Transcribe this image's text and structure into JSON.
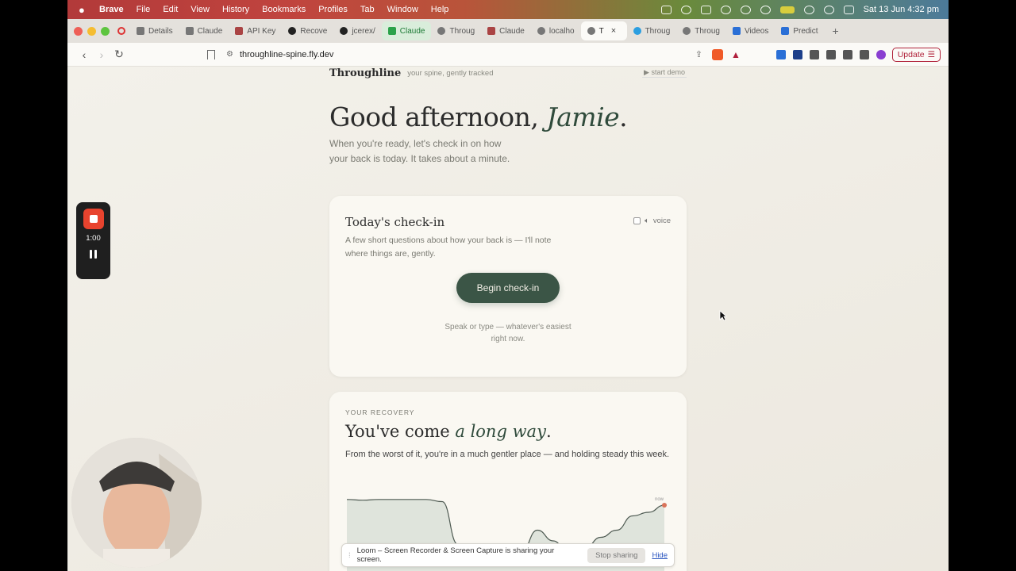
{
  "menubar": {
    "app": "Brave",
    "items": [
      "File",
      "Edit",
      "View",
      "History",
      "Bookmarks",
      "Profiles",
      "Tab",
      "Window",
      "Help"
    ],
    "clock": "Sat 13 Jun  4:32 pm"
  },
  "tabs": [
    {
      "label": "Details",
      "icon": "claude-ai-icon"
    },
    {
      "label": "Claude",
      "icon": "claude-ai-icon"
    },
    {
      "label": "API Key",
      "icon": "app-icon"
    },
    {
      "label": "Recove",
      "icon": "app-icon"
    },
    {
      "label": "jcerex/",
      "icon": "github-icon"
    },
    {
      "label": "Claude",
      "icon": "check-icon",
      "state": "green"
    },
    {
      "label": "Throug",
      "icon": "globe-icon"
    },
    {
      "label": "Claude",
      "icon": "app-icon"
    },
    {
      "label": "localho",
      "icon": "globe-icon"
    },
    {
      "label": "T",
      "icon": "globe-icon",
      "state": "active"
    },
    {
      "label": "Throug",
      "icon": "telegram-icon"
    },
    {
      "label": "Throug",
      "icon": "globe-icon"
    },
    {
      "label": "Videos",
      "icon": "app-icon"
    },
    {
      "label": "Predict",
      "icon": "app-icon"
    }
  ],
  "address": {
    "url": "throughline-spine.fly.dev"
  },
  "update_label": "Update",
  "app": {
    "brand": "Throughline",
    "tagline": "your spine, gently tracked",
    "demo_link": "▶ start demo",
    "greeting_prefix": "Good afternoon, ",
    "greeting_name": "Jamie",
    "greeting_suffix": ".",
    "subtitle": "When you're ready, let's check in on how your back is today. It takes about a minute."
  },
  "checkin": {
    "title": "Today's check-in",
    "description": "A few short questions about how your back is — I'll note where things are, gently.",
    "voice_label": "voice",
    "button": "Begin check-in",
    "hint": "Speak or type — whatever's easiest right now."
  },
  "recovery": {
    "eyebrow": "YOUR RECOVERY",
    "title_prefix": "You've come ",
    "title_em": "a long way",
    "title_suffix": ".",
    "description": "From the worst of it, you're in a much gentler place — and holding steady this week.",
    "now_label": "now"
  },
  "chart_data": {
    "type": "area",
    "title": "",
    "xlabel": "",
    "ylabel": "",
    "x": [
      0,
      1,
      2,
      3,
      4,
      5,
      6,
      7,
      8,
      9,
      10,
      11,
      12,
      13,
      14,
      15,
      16,
      17,
      18,
      19,
      20
    ],
    "values": [
      0.98,
      0.97,
      0.98,
      0.98,
      0.98,
      0.98,
      0.95,
      0.35,
      0.2,
      0.22,
      0.15,
      0.25,
      0.55,
      0.4,
      0.2,
      0.3,
      0.45,
      0.55,
      0.75,
      0.8,
      0.9
    ],
    "color": "#3b5546",
    "end_marker_color": "#d9735a"
  },
  "recorder": {
    "time": "1:00"
  },
  "share_bar": {
    "message": "Loom – Screen Recorder & Screen Capture is sharing your screen.",
    "stop": "Stop sharing",
    "hide": "Hide"
  }
}
